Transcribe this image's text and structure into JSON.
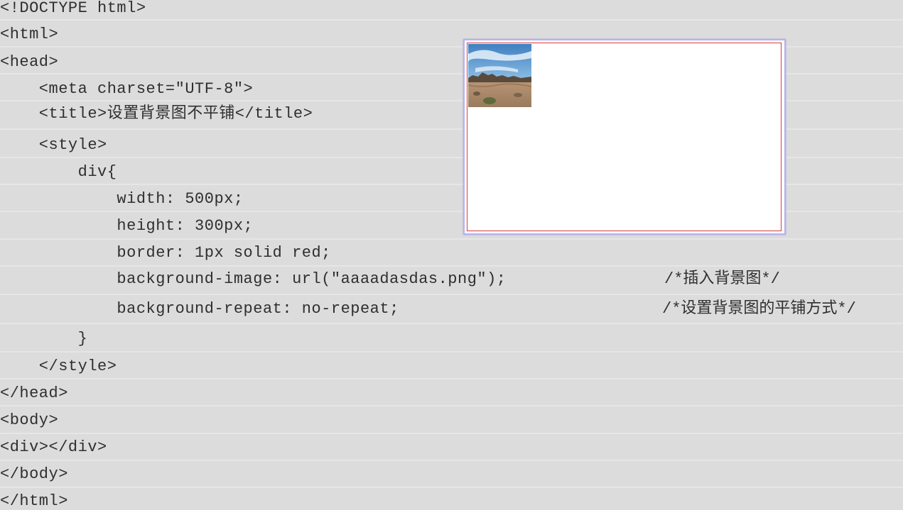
{
  "code": {
    "lines": [
      "<!DOCTYPE html>",
      "<html>",
      "<head>",
      "    <meta charset=\"UTF-8\">",
      "    <title>设置背景图不平铺</title>",
      "    <style>",
      "        div{",
      "            width: 500px;",
      "            height: 300px;",
      "            border: 1px solid red;",
      "            background-image: url(\"aaaadasdas.png\");",
      "            background-repeat: no-repeat;",
      "        }",
      "    </style>",
      "</head>",
      "<body>",
      "<div></div>",
      "</body>",
      "</html>"
    ],
    "comments": {
      "background_image": "/*插入背景图*/",
      "background_repeat": "/*设置背景图的平铺方式*/"
    }
  },
  "preview": {
    "background_image": "desert-landscape-thumbnail",
    "border_color": "#d83a3a",
    "frame_color": "#b6b2ee"
  }
}
